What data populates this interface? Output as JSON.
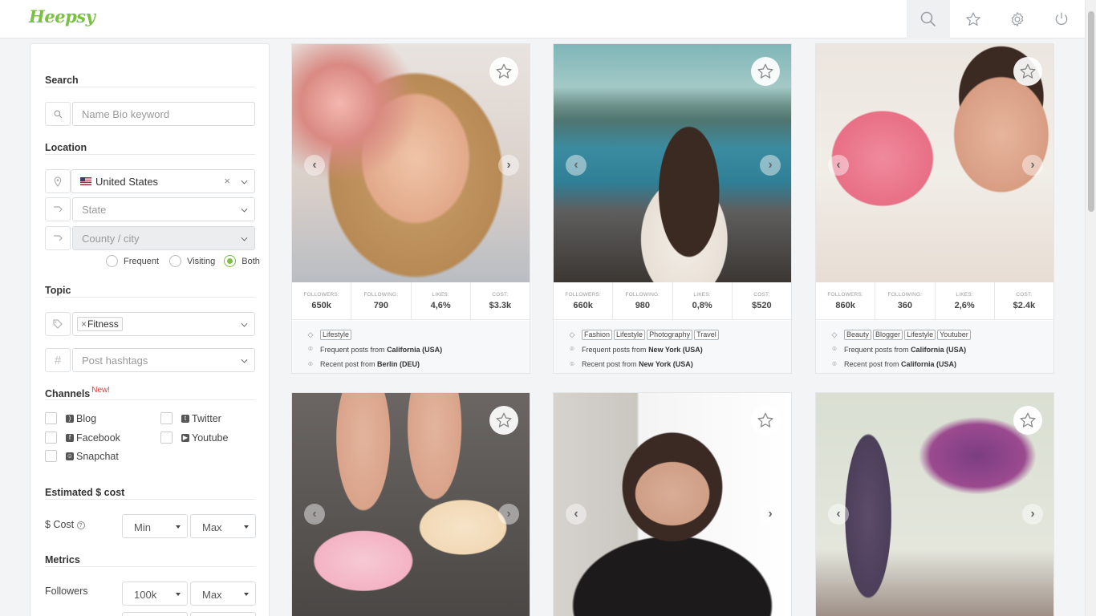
{
  "app": {
    "logo": "Heepsy"
  },
  "nav": {
    "items": [
      {
        "name": "search-icon",
        "active": true
      },
      {
        "name": "star-icon",
        "active": false
      },
      {
        "name": "gear-icon",
        "active": false
      },
      {
        "name": "power-icon",
        "active": false
      }
    ]
  },
  "sidebar": {
    "search": {
      "title": "Search",
      "placeholder": "Name Bio keyword"
    },
    "location": {
      "title": "Location",
      "country": "United States",
      "state_placeholder": "State",
      "city_placeholder": "County / city",
      "radios": [
        {
          "label": "Frequent",
          "selected": false
        },
        {
          "label": "Visiting",
          "selected": false
        },
        {
          "label": "Both",
          "selected": true
        }
      ]
    },
    "topic": {
      "title": "Topic",
      "chip": "Fitness",
      "chip_remove": "×",
      "hashtags_placeholder": "Post hashtags"
    },
    "channels": {
      "title": "Channels",
      "new_badge": "New!",
      "items": [
        {
          "label": "Blog",
          "checked": false
        },
        {
          "label": "Twitter",
          "checked": false
        },
        {
          "label": "Facebook",
          "checked": false
        },
        {
          "label": "Youtube",
          "checked": false
        },
        {
          "label": "Snapchat",
          "checked": false
        }
      ]
    },
    "cost": {
      "title": "Estimated $ cost",
      "label": "$ Cost",
      "min": "Min",
      "max": "Max"
    },
    "metrics": {
      "title": "Metrics",
      "followers_label": "Followers",
      "followers_min": "100k",
      "followers_max": "Max"
    }
  },
  "stat_labels": {
    "followers": "Followers:",
    "following": "Following:",
    "likes": "Likes:",
    "cost": "Cost:"
  },
  "cards": [
    {
      "followers": "650k",
      "following": "790",
      "likes": "4,6%",
      "cost": "$3.3k",
      "tags": [
        "Lifestyle"
      ],
      "frequent_prefix": "Frequent posts from",
      "frequent": "California (USA)",
      "recent_prefix": "Recent post from",
      "recent": "Berlin (DEU)"
    },
    {
      "followers": "660k",
      "following": "980",
      "likes": "0,8%",
      "cost": "$520",
      "tags": [
        "Fashion",
        "Lifestyle",
        "Photography",
        "Travel"
      ],
      "frequent_prefix": "Frequent posts from",
      "frequent": "New York (USA)",
      "recent_prefix": "Recent post from",
      "recent": "New York (USA)"
    },
    {
      "followers": "860k",
      "following": "360",
      "likes": "2,6%",
      "cost": "$2.4k",
      "tags": [
        "Beauty",
        "Blogger",
        "Lifestyle",
        "Youtuber"
      ],
      "frequent_prefix": "Frequent posts from",
      "frequent": "California (USA)",
      "recent_prefix": "Recent post from",
      "recent": "California (USA)"
    }
  ],
  "colors": {
    "accent": "#7ac142",
    "new_badge": "#e53935"
  }
}
